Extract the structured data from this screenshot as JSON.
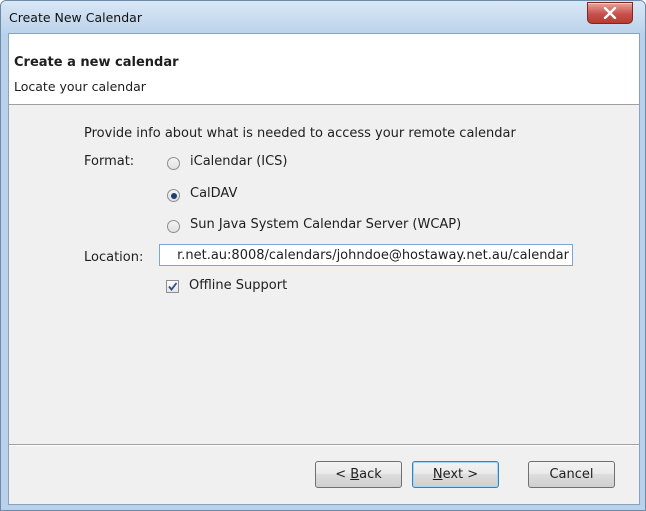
{
  "window": {
    "title": "Create New Calendar"
  },
  "header": {
    "title": "Create a new calendar",
    "subtitle": "Locate your calendar"
  },
  "form": {
    "description": "Provide info about what is needed to access your remote calendar",
    "format_label": "Format:",
    "format_options": [
      {
        "label": "iCalendar (ICS)",
        "selected": false
      },
      {
        "label": "CalDAV",
        "selected": true
      },
      {
        "label": "Sun Java System Calendar Server (WCAP)",
        "selected": false
      }
    ],
    "location_label": "Location:",
    "location_value": "r.net.au:8008/calendars/johndoe@hostaway.net.au/calendar",
    "offline_label": "Offline Support",
    "offline_checked": true
  },
  "buttons": {
    "back_prefix": "< ",
    "back_key": "B",
    "back_rest": "ack",
    "next_key": "N",
    "next_rest": "ext >",
    "cancel": "Cancel"
  },
  "icons": {
    "close": "close-icon",
    "checkmark": "checkmark-icon"
  },
  "colors": {
    "title_bar": "#bcd3eb",
    "close_button": "#c75050",
    "dialog_bg": "#f0f0f0"
  }
}
